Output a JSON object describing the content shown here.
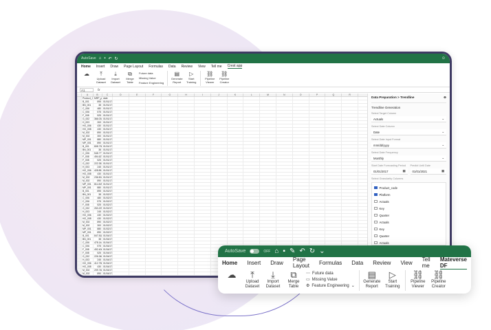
{
  "window": {
    "autosave": "AutoSave",
    "menu": [
      "Home",
      "Insert",
      "Draw",
      "Page Layout",
      "Formulas",
      "Data",
      "Review",
      "View",
      "Tell me",
      "Crest app"
    ],
    "ribbon": {
      "upload": "Upload Dataset",
      "import": "Import Dataset",
      "merge": "Merge Table",
      "future": "Future data",
      "missing": "Missing Value",
      "feature": "Feature Engineering",
      "generate": "Generate Report",
      "start": "Start Training",
      "viewer": "Pipeline Viewer",
      "creator": "Pipeline Creator"
    },
    "cellref": "A1",
    "fx": "fx"
  },
  "sheet": {
    "columns": [
      "A",
      "B",
      "C",
      "D",
      "E",
      "F",
      "G",
      "H",
      "I",
      "J",
      "K",
      "L",
      "M",
      "N",
      "O",
      "P",
      "Q",
      "R"
    ],
    "headers": [
      "Product_Code",
      "MRP_price",
      "date"
    ],
    "rows": [
      [
        "B_001",
        "895",
        "01/01/17"
      ],
      [
        "BN_001",
        "38",
        "01/01/17"
      ],
      [
        "C_006",
        "480",
        "01/01/17"
      ],
      [
        "C_006",
        "575",
        "01/01/17"
      ],
      [
        "F_008",
        "525",
        "01/01/17"
      ],
      [
        "G_002",
        "366.034701",
        "01/01/17"
      ],
      [
        "H_003",
        "263",
        "01/01/17"
      ],
      [
        "HO_006",
        "430",
        "01/01/17"
      ],
      [
        "HO_008",
        "430",
        "01/01/17"
      ],
      [
        "M_002",
        "890",
        "01/01/17"
      ],
      [
        "M_002",
        "300",
        "01/01/17"
      ],
      [
        "MP_001",
        "880",
        "01/01/17"
      ],
      [
        "MP_001",
        "890",
        "01/01/17"
      ],
      [
        "B_001",
        "808.730904",
        "01/01/17"
      ],
      [
        "BN_001",
        "38",
        "01/01/17"
      ],
      [
        "C_006",
        "548.777778",
        "01/01/17"
      ],
      [
        "F_008",
        "494.627125",
        "01/01/17"
      ],
      [
        "F_008",
        "525",
        "01/01/17"
      ],
      [
        "G_002",
        "222.351852",
        "01/01/17"
      ],
      [
        "H_003",
        "245",
        "01/01/17"
      ],
      [
        "HO_006",
        "428.85",
        "01/01/17"
      ],
      [
        "HO_008",
        "430",
        "01/01/17"
      ],
      [
        "M_002",
        "236.50424",
        "01/01/17"
      ],
      [
        "M_002",
        "890",
        "01/01/17"
      ],
      [
        "MP_001",
        "811.849131",
        "01/01/17"
      ],
      [
        "MP_001",
        "880",
        "01/01/17"
      ],
      [
        "B_001",
        "895",
        "01/02/17"
      ],
      [
        "BN_001",
        "38",
        "01/02/17"
      ],
      [
        "C_006",
        "480",
        "01/02/17"
      ],
      [
        "C_006",
        "575",
        "01/02/17"
      ],
      [
        "F_008",
        "525",
        "01/02/17"
      ],
      [
        "G_002",
        "263.229885",
        "01/02/17"
      ],
      [
        "H_003",
        "245",
        "01/02/17"
      ],
      [
        "HO_006",
        "430",
        "01/02/17"
      ],
      [
        "HO_008",
        "430",
        "01/02/17"
      ],
      [
        "M_002",
        "890",
        "01/02/17"
      ],
      [
        "M_002",
        "300",
        "01/02/17"
      ],
      [
        "MP_001",
        "880",
        "01/02/17"
      ],
      [
        "MP_001",
        "890",
        "01/02/17"
      ],
      [
        "B_001",
        "847.818444",
        "01/04/17"
      ],
      [
        "BN_001",
        "38",
        "01/04/17"
      ],
      [
        "C_006",
        "478.144538",
        "01/04/17"
      ],
      [
        "C_006",
        "575",
        "01/04/17"
      ],
      [
        "F_008",
        "492.40678",
        "01/04/17"
      ],
      [
        "F_008",
        "525",
        "01/04/17"
      ],
      [
        "G_002",
        "226.340782",
        "01/04/17"
      ],
      [
        "H_003",
        "245",
        "01/04/17"
      ],
      [
        "HO_006",
        "412.756447",
        "01/04/17"
      ],
      [
        "HO_008",
        "430",
        "01/04/17"
      ],
      [
        "M_002",
        "209.74863",
        "01/04/17"
      ],
      [
        "M_002",
        "890",
        "01/04/17"
      ]
    ]
  },
  "panel": {
    "title": "Data Preparation > Trendline",
    "subtitle": "Trendline Generation",
    "target_label": "Select Target Column",
    "target_value": "Actuals",
    "date_label": "Select Date Column",
    "date_value": "Date",
    "format_label": "Select Date Input Format",
    "format_value": "mm/dd/yyyy",
    "freq_label": "Select Date Frequency",
    "freq_value": "Monthly",
    "start_label": "Start Date Forecasting Period",
    "start_value": "01/01/2017",
    "end_label": "Predict Until Date",
    "end_value": "01/01/2021",
    "gran_label": "Select Granularity Columns",
    "columns": [
      {
        "label": "Product_code",
        "checked": true
      },
      {
        "label": "Platform",
        "checked": true
      },
      {
        "label": "Actuals",
        "checked": false
      },
      {
        "label": "Key",
        "checked": false
      },
      {
        "label": "Quarter",
        "checked": false
      },
      {
        "label": "Actuals",
        "checked": false
      },
      {
        "label": "Key",
        "checked": false
      },
      {
        "label": "Quarter",
        "checked": false
      },
      {
        "label": "Actuals",
        "checked": false
      }
    ]
  },
  "card": {
    "autosave": "AutoSave",
    "off": "OFF",
    "menu": [
      "Home",
      "Insert",
      "Draw",
      "Page Layout",
      "Formulas",
      "Data",
      "Review",
      "View",
      "Tell me",
      "Mateverse DF"
    ],
    "upload": "Upload Dataset",
    "import": "Import Dataset",
    "merge": "Merge Table",
    "future": "Future data",
    "missing": "Missing Value",
    "feature": "Feature Engineering",
    "generate": "Generate Report",
    "start": "Start Training",
    "viewer": "Pipeline Viewer",
    "creator": "Pipeline Creator"
  },
  "colors": {
    "excel_green": "#217346",
    "frame": "#3e3a63",
    "check": "#2f5fc0"
  }
}
